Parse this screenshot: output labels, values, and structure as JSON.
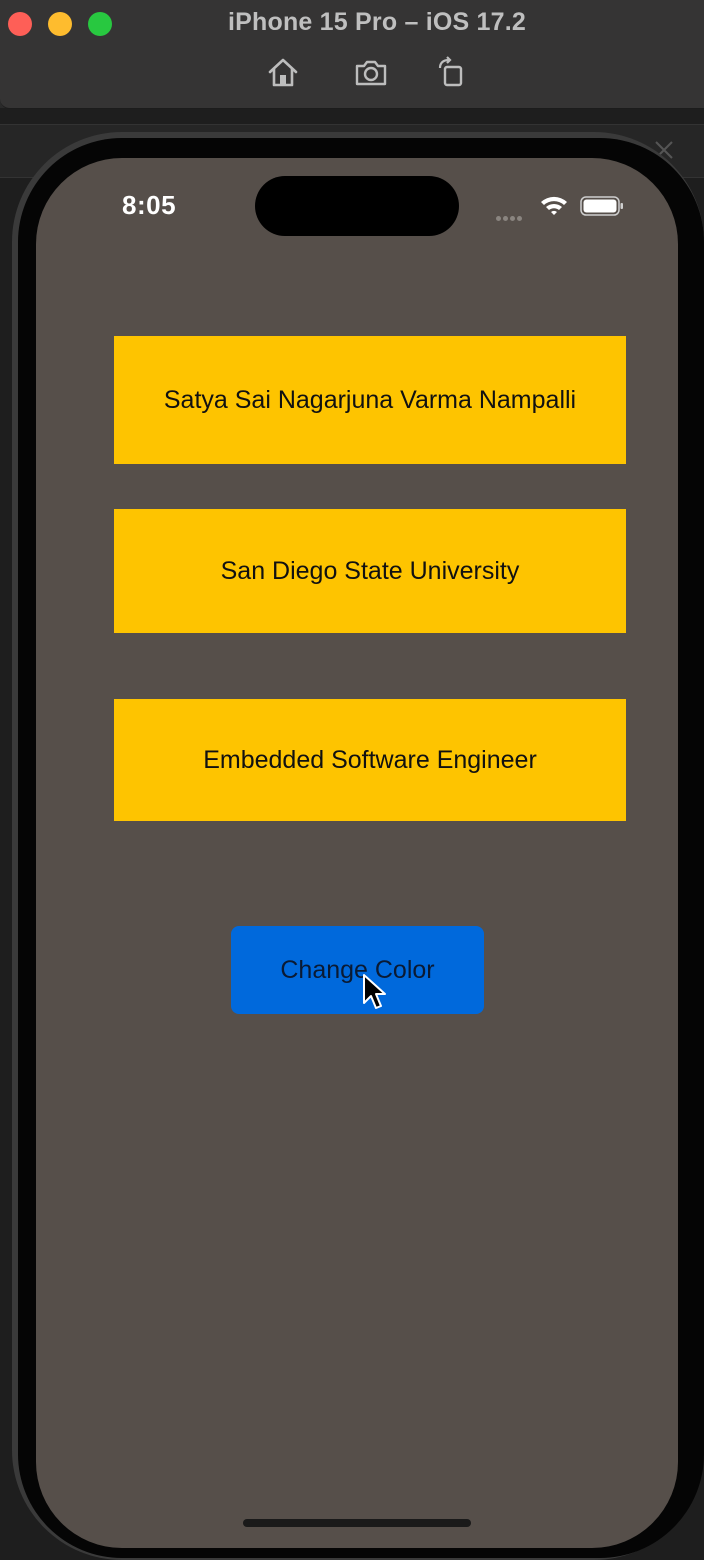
{
  "window": {
    "title": "iPhone 15 Pro – iOS 17.2",
    "toolbar": {
      "home_icon": "home-icon",
      "screenshot_icon": "camera-icon",
      "rotate_icon": "rotate-icon"
    }
  },
  "status_bar": {
    "time": "8:05"
  },
  "app": {
    "labels": [
      "Satya Sai Nagarjuna Varma Nampalli",
      "San Diego State University",
      "Embedded Software Engineer"
    ],
    "button_label": "Change Color"
  },
  "colors": {
    "screen_background": "#564f4a",
    "label_background": "#fec400",
    "button_background": "#0069dc"
  }
}
